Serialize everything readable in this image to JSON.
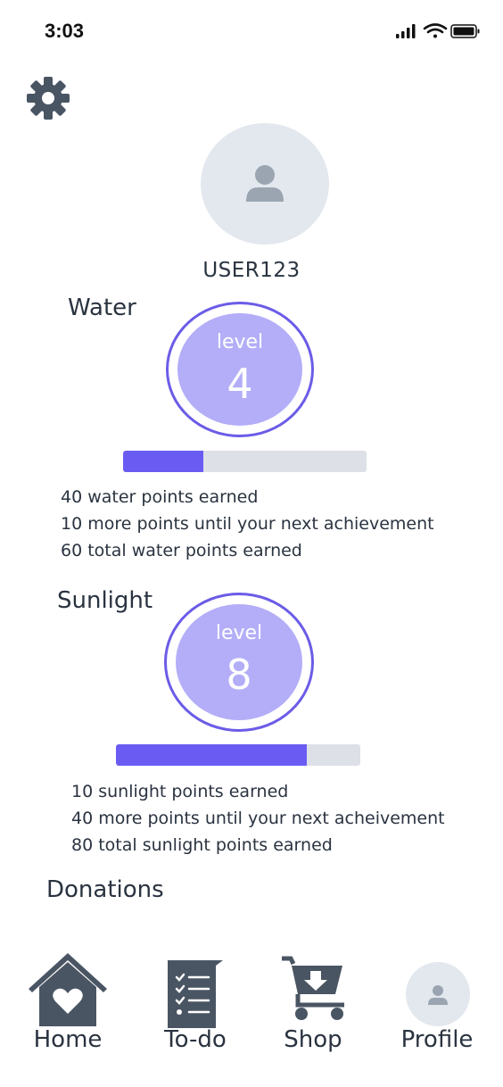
{
  "status_bar": {
    "time": "3:03"
  },
  "profile": {
    "username": "USER123"
  },
  "water": {
    "title": "Water",
    "level_word": "level",
    "level_value": "4",
    "progress_fraction": 0.33,
    "lines": [
      "40 water points earned",
      "10 more points until your next achievement",
      "60 total water points earned"
    ]
  },
  "sunlight": {
    "title": "Sunlight",
    "level_word": "level",
    "level_value": "8",
    "progress_fraction": 0.78,
    "lines": [
      "10 sunlight points earned",
      "40 more points until your next acheivement",
      "80 total sunlight points earned"
    ]
  },
  "donations": {
    "title": "Donations"
  },
  "nav": [
    {
      "label": "Home",
      "icon": "home-heart-icon"
    },
    {
      "label": "To-do",
      "icon": "checklist-icon"
    },
    {
      "label": "Shop",
      "icon": "cart-icon"
    },
    {
      "label": "Profile",
      "icon": "person-icon"
    }
  ],
  "colors": {
    "accent": "#6a5cf3",
    "level_fill": "#b3aef7",
    "track": "#dde1e7",
    "icon_dark": "#4a5563",
    "avatar_bg": "#e3e7ee"
  }
}
